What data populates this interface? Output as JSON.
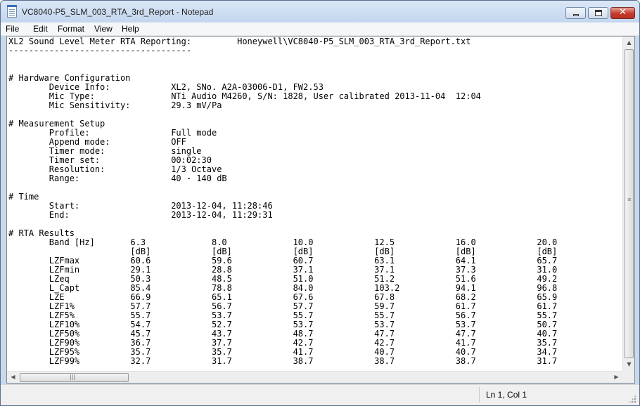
{
  "window": {
    "title": "VC8040-P5_SLM_003_RTA_3rd_Report - Notepad"
  },
  "menu": [
    {
      "label": "File"
    },
    {
      "label": "Edit"
    },
    {
      "label": "Format"
    },
    {
      "label": "View"
    },
    {
      "label": "Help"
    }
  ],
  "caption_buttons": {
    "close_glyph": "✕"
  },
  "document": {
    "text": "XL2 Sound Level Meter RTA Reporting:         Honeywell\\VC8040-P5_SLM_003_RTA_3rd_Report.txt\n------------------------------------\n\n\n# Hardware Configuration\n        Device Info:            XL2, SNo. A2A-03006-D1, FW2.53\n        Mic Type:               NTi Audio M4260, S/N: 1828, User calibrated 2013-11-04  12:04\n        Mic Sensitivity:        29.3 mV/Pa\n\n# Measurement Setup\n        Profile:                Full mode\n        Append mode:            OFF\n        Timer mode:             single\n        Timer set:              00:02:30\n        Resolution:             1/3 Octave\n        Range:                  40 - 140 dB\n\n# Time\n        Start:                  2013-12-04, 11:28:46\n        End:                    2013-12-04, 11:29:31\n\n# RTA Results\n        Band [Hz]       6.3             8.0             10.0            12.5            16.0            20.0\n                        [dB]            [dB]            [dB]            [dB]            [dB]            [dB]\n        LZFmax          60.6            59.6            60.7            63.1            64.1            65.7\n        LZFmin          29.1            28.8            37.1            37.1            37.3            31.0\n        LZeq            50.3            48.5            51.0            51.2            51.6            49.2\n        L_Capt          85.4            78.8            84.0            103.2           94.1            96.8\n        LZE             66.9            65.1            67.6            67.8            68.2            65.9\n        LZF1%           57.7            56.7            57.7            59.7            61.7            61.7\n        LZF5%           55.7            53.7            55.7            55.7            56.7            55.7\n        LZF10%          54.7            52.7            53.7            53.7            53.7            50.7\n        LZF50%          45.7            43.7            48.7            47.7            47.7            40.7\n        LZF90%          36.7            37.7            42.7            42.7            41.7            35.7\n        LZF95%          35.7            35.7            41.7            40.7            40.7            34.7\n        LZF99%          32.7            31.7            38.7            38.7            38.7            31.7"
  },
  "scrollbars": {
    "up_arrow": "▲",
    "down_arrow": "▼",
    "left_arrow": "◀",
    "right_arrow": "▶",
    "h_grip": "|||",
    "v_grip": "≡"
  },
  "status": {
    "position": "Ln 1, Col 1"
  }
}
